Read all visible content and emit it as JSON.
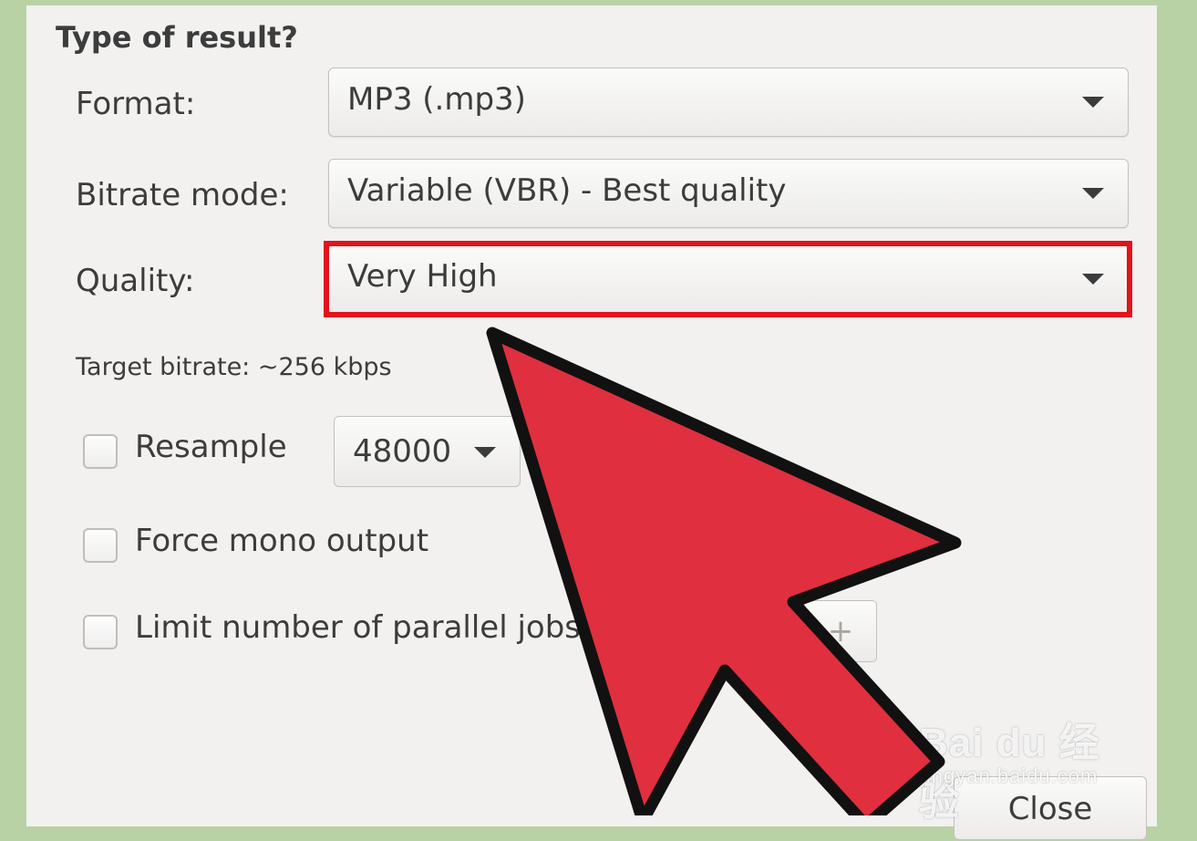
{
  "section": {
    "title": "Type of result?"
  },
  "format": {
    "label": "Format:",
    "value": "MP3 (.mp3)"
  },
  "bitrate_mode": {
    "label": "Bitrate mode:",
    "value": "Variable (VBR) - Best quality"
  },
  "quality": {
    "label": "Quality:",
    "value": "Very High"
  },
  "target_bitrate": {
    "text": "Target bitrate: ~256 kbps"
  },
  "resample": {
    "label": "Resample",
    "checked": false,
    "rate": "48000"
  },
  "force_mono": {
    "label": "Force mono output",
    "checked": false
  },
  "limit_jobs": {
    "label": "Limit number of parallel jobs",
    "checked": false,
    "increment_label": "+"
  },
  "buttons": {
    "close_label": "Close"
  },
  "watermark": {
    "logo_text": "Bai du 经验",
    "url": "jingyan.baidu.com"
  },
  "colors": {
    "highlight": "#e3121b",
    "pointer_fill": "#e02f3f",
    "pointer_stroke": "#111111",
    "background_frame": "#b9d2a5",
    "dialog_background": "#f2f1f0"
  },
  "icons": {
    "combo_arrow": "chevron-down-icon",
    "pointer": "arrow-pointer-icon"
  }
}
